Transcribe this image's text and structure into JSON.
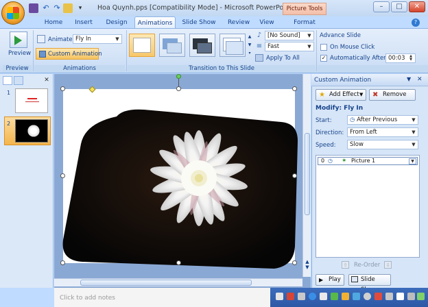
{
  "window": {
    "title": "Hoa Quynh.pps [Compatibility Mode] - Microsoft PowerPoint n...",
    "contextual_tab": "Picture Tools"
  },
  "tabs": [
    "Home",
    "Insert",
    "Design",
    "Animations",
    "Slide Show",
    "Review",
    "View",
    "Format"
  ],
  "ribbon": {
    "preview": {
      "button": "Preview",
      "group": "Preview"
    },
    "animations": {
      "animate_label": "Animate:",
      "animate_value": "Fly In",
      "custom_animation": "Custom Animation",
      "group": "Animations"
    },
    "transition": {
      "sound_value": "[No Sound]",
      "speed_value": "Fast",
      "apply_to_all": "Apply To All",
      "group": "Transition to This Slide"
    },
    "advance": {
      "title": "Advance Slide",
      "on_mouse_click": "On Mouse Click",
      "automatically_after": "Automatically After:",
      "time_value": "00:03"
    }
  },
  "slides_pane": {
    "slide_numbers": [
      "1",
      "2"
    ]
  },
  "anim_pane": {
    "title": "Custom Animation",
    "add_effect": "Add Effect",
    "remove": "Remove",
    "modify": "Modify: Fly In",
    "start_label": "Start:",
    "start_value": "After Previous",
    "direction_label": "Direction:",
    "direction_value": "From Left",
    "speed_label": "Speed:",
    "speed_value": "Slow",
    "item_index": "0",
    "item_name": "Picture 1",
    "reorder": "Re-Order",
    "play": "Play",
    "slide_show": "Slide Show"
  },
  "notes_placeholder": "Click to add notes",
  "colors": {
    "ribbon_bg": "#d5e4f7",
    "accent_text": "#15428b",
    "selected_orange": "#f8c86a",
    "taskbar": "#2d58a6"
  }
}
